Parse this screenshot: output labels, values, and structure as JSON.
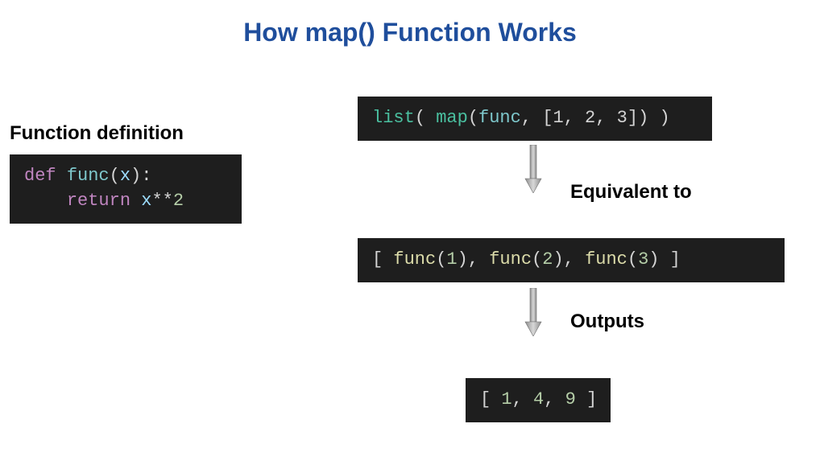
{
  "title": "How map() Function Works",
  "labels": {
    "function_definition": "Function definition",
    "equivalent_to": "Equivalent to",
    "outputs": "Outputs"
  },
  "code": {
    "func_def": {
      "kw_def": "def",
      "name": "func",
      "param": "x",
      "kw_return": "return",
      "var": "x",
      "op": "**",
      "exp": "2"
    },
    "map_call": {
      "builtin_list": "list",
      "builtin_map": "map",
      "fn": "func",
      "args": "[1, 2, 3]"
    },
    "expanded": {
      "fn": "func",
      "a1": "1",
      "a2": "2",
      "a3": "3"
    },
    "result": {
      "v1": "1",
      "v2": "4",
      "v3": "9"
    }
  }
}
